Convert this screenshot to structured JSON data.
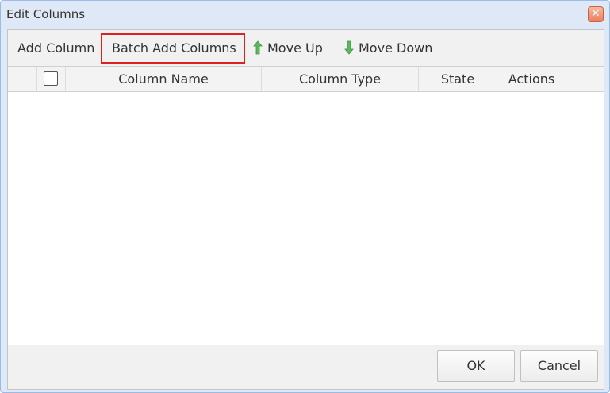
{
  "dialog": {
    "title": "Edit Columns"
  },
  "toolbar": {
    "add_column": "Add Column",
    "batch_add_columns": "Batch Add Columns",
    "move_up": "Move Up",
    "move_down": "Move Down",
    "highlight_color": "#e02020",
    "move_up_icon": "green-arrow-up-icon",
    "move_down_icon": "green-arrow-down-icon"
  },
  "grid": {
    "columns": [
      "Column Name",
      "Column Type",
      "State",
      "Actions"
    ],
    "rows": []
  },
  "footer": {
    "ok": "OK",
    "cancel": "Cancel"
  }
}
